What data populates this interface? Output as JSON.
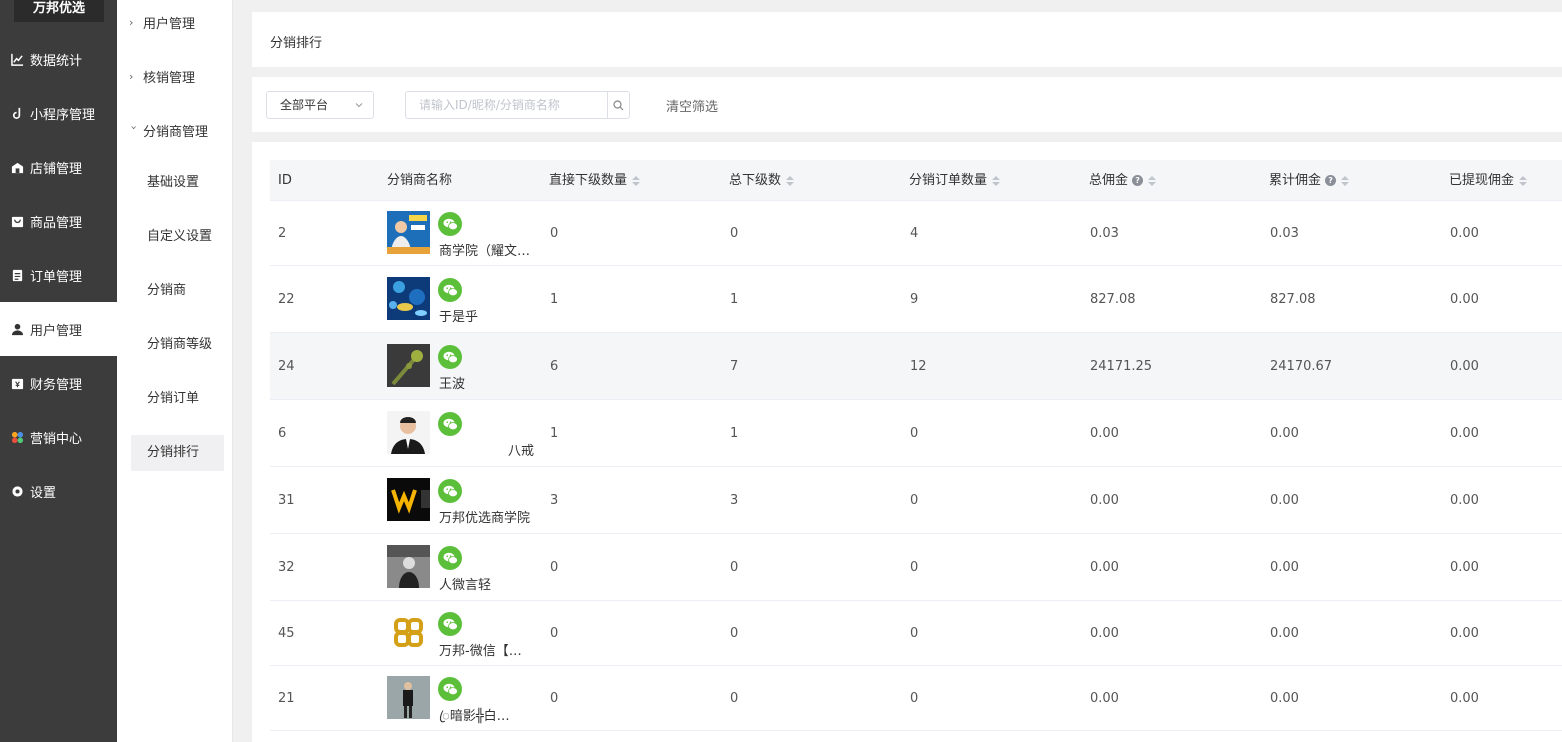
{
  "app": {
    "logo": "万邦优选"
  },
  "sidebar": {
    "items": [
      {
        "label": "数据统计",
        "icon": "chart-icon"
      },
      {
        "label": "小程序管理",
        "icon": "link-icon"
      },
      {
        "label": "店铺管理",
        "icon": "store-icon"
      },
      {
        "label": "商品管理",
        "icon": "goods-icon"
      },
      {
        "label": "订单管理",
        "icon": "order-icon"
      },
      {
        "label": "用户管理",
        "icon": "user-icon",
        "active": true
      },
      {
        "label": "财务管理",
        "icon": "finance-icon"
      },
      {
        "label": "营销中心",
        "icon": "marketing-icon"
      },
      {
        "label": "设置",
        "icon": "settings-icon"
      }
    ]
  },
  "subnav": {
    "groups": [
      {
        "label": "用户管理",
        "expanded": false
      },
      {
        "label": "核销管理",
        "expanded": false
      },
      {
        "label": "分销商管理",
        "expanded": true
      }
    ],
    "items": [
      {
        "label": "基础设置"
      },
      {
        "label": "自定义设置"
      },
      {
        "label": "分销商"
      },
      {
        "label": "分销商等级"
      },
      {
        "label": "分销订单"
      },
      {
        "label": "分销排行",
        "active": true
      }
    ]
  },
  "page": {
    "title": "分销排行"
  },
  "filters": {
    "platform": "全部平台",
    "search_placeholder": "请输入ID/昵称/分销商名称",
    "clear_label": "清空筛选"
  },
  "table": {
    "columns": [
      {
        "label": "ID",
        "sortable": false,
        "help": false
      },
      {
        "label": "分销商名称",
        "sortable": false,
        "help": false
      },
      {
        "label": "直接下级数量",
        "sortable": true,
        "help": false
      },
      {
        "label": "总下级数",
        "sortable": true,
        "help": false
      },
      {
        "label": "分销订单数量",
        "sortable": true,
        "help": false
      },
      {
        "label": "总佣金",
        "sortable": true,
        "help": true
      },
      {
        "label": "累计佣金",
        "sortable": true,
        "help": true
      },
      {
        "label": "已提现佣金",
        "sortable": true,
        "help": false
      }
    ],
    "rows": [
      {
        "id": "2",
        "name": "商学院（耀文…",
        "direct": "0",
        "total": "0",
        "orders": "4",
        "commission": "0.03",
        "cumulative": "0.03",
        "withdrawn": "0.00",
        "avatar": "avatar-poster"
      },
      {
        "id": "22",
        "name": "于是乎",
        "direct": "1",
        "total": "1",
        "orders": "9",
        "commission": "827.08",
        "cumulative": "827.08",
        "withdrawn": "0.00",
        "avatar": "avatar-fish"
      },
      {
        "id": "24",
        "name": "王波",
        "direct": "6",
        "total": "7",
        "orders": "12",
        "commission": "24171.25",
        "cumulative": "24170.67",
        "withdrawn": "0.00",
        "avatar": "avatar-plant"
      },
      {
        "id": "6",
        "name": "八戒",
        "direct": "1",
        "total": "1",
        "orders": "0",
        "commission": "0.00",
        "cumulative": "0.00",
        "withdrawn": "0.00",
        "avatar": "avatar-man"
      },
      {
        "id": "31",
        "name": "万邦优选商学院",
        "direct": "3",
        "total": "3",
        "orders": "0",
        "commission": "0.00",
        "cumulative": "0.00",
        "withdrawn": "0.00",
        "avatar": "avatar-w-logo"
      },
      {
        "id": "32",
        "name": "人微言轻",
        "direct": "0",
        "total": "0",
        "orders": "0",
        "commission": "0.00",
        "cumulative": "0.00",
        "withdrawn": "0.00",
        "avatar": "avatar-bw"
      },
      {
        "id": "45",
        "name": "万邦-微信【官…",
        "direct": "0",
        "total": "0",
        "orders": "0",
        "commission": "0.00",
        "cumulative": "0.00",
        "withdrawn": "0.00",
        "avatar": "avatar-knot"
      },
      {
        "id": "21",
        "name": "ꦿ暗影╬白…",
        "direct": "0",
        "total": "0",
        "orders": "0",
        "commission": "0.00",
        "cumulative": "0.00",
        "withdrawn": "0.00",
        "avatar": "avatar-standing"
      }
    ]
  },
  "colors": {
    "sidebar_bg": "#3c3c3c",
    "wechat_green": "#5cbf3a",
    "accent": "#ffffff"
  }
}
